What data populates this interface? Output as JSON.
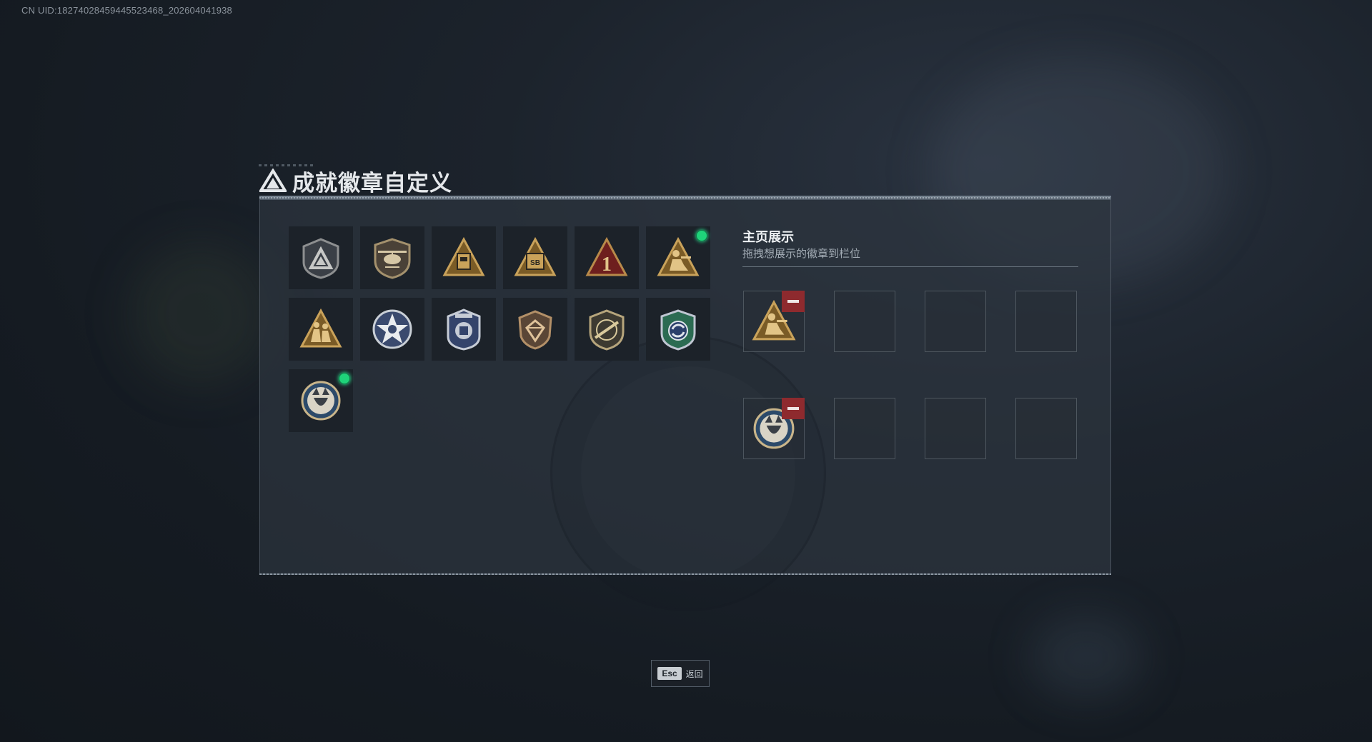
{
  "uid_text": "CN UID:18274028459445523468_202604041938",
  "title": "成就徽章自定义",
  "showcase": {
    "title": "主页展示",
    "subtitle": "拖拽想展示的徽章到栏位"
  },
  "badges": [
    {
      "icon": "triangle-emblem-shield-badge",
      "new": false
    },
    {
      "icon": "helicopter-shield-badge",
      "new": false
    },
    {
      "icon": "golden-tablet-pyramid-badge",
      "new": false
    },
    {
      "icon": "sb-crate-pyramid-badge",
      "new": false
    },
    {
      "icon": "number-one-red-pyramid-badge",
      "new": false
    },
    {
      "icon": "kneeling-soldier-pyramid-badge",
      "new": true
    },
    {
      "icon": "soldiers-pyramid-badge",
      "new": false
    },
    {
      "icon": "star-skull-medal-badge",
      "new": false
    },
    {
      "icon": "blue-police-emblem-badge",
      "new": false
    },
    {
      "icon": "diamond-shield-badge",
      "new": false
    },
    {
      "icon": "rifle-shield-badge",
      "new": false
    },
    {
      "icon": "green-cycle-shield-badge",
      "new": false
    },
    {
      "icon": "wolf-round-badge",
      "new": true
    }
  ],
  "slots_row1": [
    "kneeling-soldier-pyramid-badge",
    "",
    "",
    ""
  ],
  "slots_row2": [
    "wolf-round-badge",
    "",
    "",
    ""
  ],
  "esc_key": "Esc",
  "esc_label": "返回",
  "colors": {
    "new_dot": "#1fd37a",
    "remove": "#8e2a2e",
    "gold": "#c9a25a"
  }
}
